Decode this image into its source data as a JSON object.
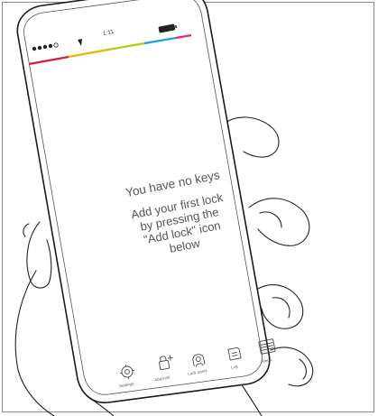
{
  "status_bar": {
    "time": "1:11",
    "signal_icon": "signal-dots-icon",
    "wifi_icon": "wifi-icon",
    "battery_icon": "battery-icon"
  },
  "accent_colors": [
    "#d21e3c",
    "#f0b400",
    "#b4c814",
    "#20a0dc",
    "#e6287a"
  ],
  "main": {
    "title": "You have no keys",
    "message": "Add your first lock\nby pressing the\n\"Add lock\" icon\nbelow"
  },
  "tabs": [
    {
      "label": "Settings",
      "icon": "settings-gear-icon"
    },
    {
      "label": "Add lock",
      "icon": "add-lock-icon"
    },
    {
      "label": "Lock users",
      "icon": "lock-users-icon"
    },
    {
      "label": "Log",
      "icon": "log-icon"
    },
    {
      "label": "Menu",
      "icon": "menu-icon"
    }
  ]
}
